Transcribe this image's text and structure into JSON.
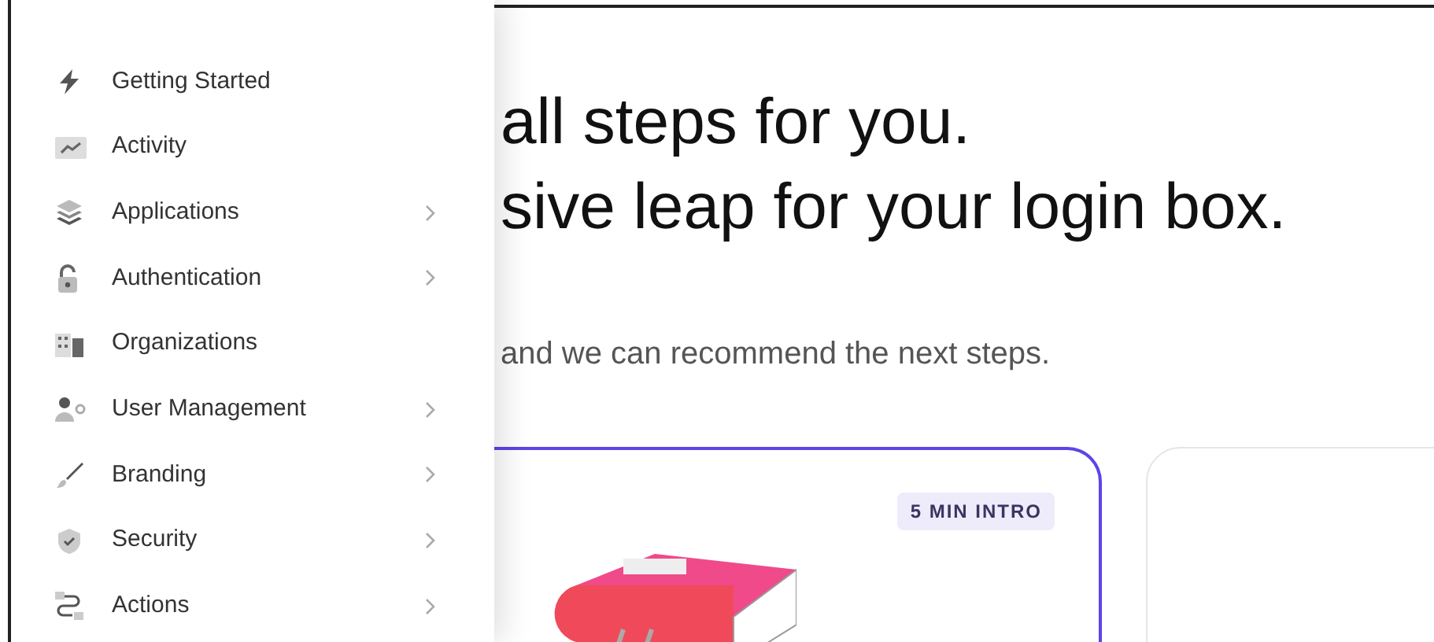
{
  "sidebar": {
    "items": [
      {
        "label": "Getting Started",
        "has_submenu": false
      },
      {
        "label": "Activity",
        "has_submenu": false
      },
      {
        "label": "Applications",
        "has_submenu": true
      },
      {
        "label": "Authentication",
        "has_submenu": true
      },
      {
        "label": "Organizations",
        "has_submenu": false
      },
      {
        "label": "User Management",
        "has_submenu": true
      },
      {
        "label": "Branding",
        "has_submenu": true
      },
      {
        "label": "Security",
        "has_submenu": true
      },
      {
        "label": "Actions",
        "has_submenu": true
      }
    ]
  },
  "main": {
    "heading_lines": [
      "all steps for you.",
      "sive leap for your login box."
    ],
    "subtitle": "and we can recommend the next steps.",
    "cards": [
      {
        "badge": "5 MIN INTRO",
        "selected": true
      },
      {
        "selected": false
      }
    ]
  }
}
